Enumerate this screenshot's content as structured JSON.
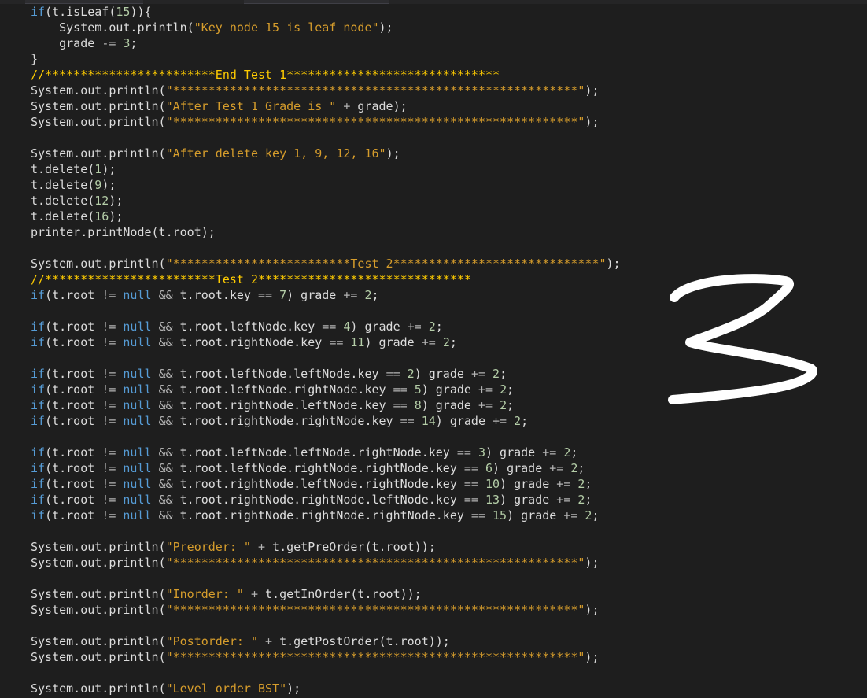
{
  "colors": {
    "background": "#1e1e1e",
    "text": "#dcdcdc",
    "keyword": "#569cd6",
    "string": "#d69d2c",
    "number": "#b5cea8",
    "comment": "#ffcc00",
    "operator": "#b4b4b4",
    "annotation": "#ffffff"
  },
  "annotation": {
    "icon": "handwritten-3-icon",
    "value": "3"
  },
  "code": {
    "lines": [
      [
        {
          "t": "kw",
          "s": "if"
        },
        {
          "t": "plain",
          "s": "(t.isLeaf("
        },
        {
          "t": "num",
          "s": "15"
        },
        {
          "t": "plain",
          "s": ")){"
        }
      ],
      [
        {
          "t": "plain",
          "s": "    System.out.println("
        },
        {
          "t": "str",
          "s": "\"Key node 15 is leaf node\""
        },
        {
          "t": "plain",
          "s": ");"
        }
      ],
      [
        {
          "t": "plain",
          "s": "    grade "
        },
        {
          "t": "op",
          "s": "-="
        },
        {
          "t": "plain",
          "s": " "
        },
        {
          "t": "num",
          "s": "3"
        },
        {
          "t": "plain",
          "s": ";"
        }
      ],
      [
        {
          "t": "plain",
          "s": "}"
        }
      ],
      [
        {
          "t": "cm",
          "s": "//************************End Test 1******************************"
        }
      ],
      [
        {
          "t": "plain",
          "s": "System.out.println("
        },
        {
          "t": "str",
          "s": "\"*********************************************************\""
        },
        {
          "t": "plain",
          "s": ");"
        }
      ],
      [
        {
          "t": "plain",
          "s": "System.out.println("
        },
        {
          "t": "str",
          "s": "\"After Test 1 Grade is \""
        },
        {
          "t": "plain",
          "s": " "
        },
        {
          "t": "op",
          "s": "+"
        },
        {
          "t": "plain",
          "s": " grade);"
        }
      ],
      [
        {
          "t": "plain",
          "s": "System.out.println("
        },
        {
          "t": "str",
          "s": "\"*********************************************************\""
        },
        {
          "t": "plain",
          "s": ");"
        }
      ],
      [],
      [
        {
          "t": "plain",
          "s": "System.out.println("
        },
        {
          "t": "str",
          "s": "\"After delete key 1, 9, 12, 16\""
        },
        {
          "t": "plain",
          "s": ");"
        }
      ],
      [
        {
          "t": "plain",
          "s": "t.delete("
        },
        {
          "t": "num",
          "s": "1"
        },
        {
          "t": "plain",
          "s": ");"
        }
      ],
      [
        {
          "t": "plain",
          "s": "t.delete("
        },
        {
          "t": "num",
          "s": "9"
        },
        {
          "t": "plain",
          "s": ");"
        }
      ],
      [
        {
          "t": "plain",
          "s": "t.delete("
        },
        {
          "t": "num",
          "s": "12"
        },
        {
          "t": "plain",
          "s": ");"
        }
      ],
      [
        {
          "t": "plain",
          "s": "t.delete("
        },
        {
          "t": "num",
          "s": "16"
        },
        {
          "t": "plain",
          "s": ");"
        }
      ],
      [
        {
          "t": "plain",
          "s": "printer.printNode(t.root);"
        }
      ],
      [],
      [
        {
          "t": "plain",
          "s": "System.out.println("
        },
        {
          "t": "str",
          "s": "\"*************************Test 2*****************************\""
        },
        {
          "t": "plain",
          "s": ");"
        }
      ],
      [
        {
          "t": "cm",
          "s": "//************************Test 2******************************"
        }
      ],
      [
        {
          "t": "kw",
          "s": "if"
        },
        {
          "t": "plain",
          "s": "(t.root "
        },
        {
          "t": "op",
          "s": "!="
        },
        {
          "t": "plain",
          "s": " "
        },
        {
          "t": "kw",
          "s": "null"
        },
        {
          "t": "plain",
          "s": " "
        },
        {
          "t": "op",
          "s": "&&"
        },
        {
          "t": "plain",
          "s": " t.root.key "
        },
        {
          "t": "op",
          "s": "=="
        },
        {
          "t": "plain",
          "s": " "
        },
        {
          "t": "num",
          "s": "7"
        },
        {
          "t": "plain",
          "s": ") grade "
        },
        {
          "t": "op",
          "s": "+="
        },
        {
          "t": "plain",
          "s": " "
        },
        {
          "t": "num",
          "s": "2"
        },
        {
          "t": "plain",
          "s": ";"
        }
      ],
      [],
      [
        {
          "t": "kw",
          "s": "if"
        },
        {
          "t": "plain",
          "s": "(t.root "
        },
        {
          "t": "op",
          "s": "!="
        },
        {
          "t": "plain",
          "s": " "
        },
        {
          "t": "kw",
          "s": "null"
        },
        {
          "t": "plain",
          "s": " "
        },
        {
          "t": "op",
          "s": "&&"
        },
        {
          "t": "plain",
          "s": " t.root.leftNode.key "
        },
        {
          "t": "op",
          "s": "=="
        },
        {
          "t": "plain",
          "s": " "
        },
        {
          "t": "num",
          "s": "4"
        },
        {
          "t": "plain",
          "s": ") grade "
        },
        {
          "t": "op",
          "s": "+="
        },
        {
          "t": "plain",
          "s": " "
        },
        {
          "t": "num",
          "s": "2"
        },
        {
          "t": "plain",
          "s": ";"
        }
      ],
      [
        {
          "t": "kw",
          "s": "if"
        },
        {
          "t": "plain",
          "s": "(t.root "
        },
        {
          "t": "op",
          "s": "!="
        },
        {
          "t": "plain",
          "s": " "
        },
        {
          "t": "kw",
          "s": "null"
        },
        {
          "t": "plain",
          "s": " "
        },
        {
          "t": "op",
          "s": "&&"
        },
        {
          "t": "plain",
          "s": " t.root.rightNode.key "
        },
        {
          "t": "op",
          "s": "=="
        },
        {
          "t": "plain",
          "s": " "
        },
        {
          "t": "num",
          "s": "11"
        },
        {
          "t": "plain",
          "s": ") grade "
        },
        {
          "t": "op",
          "s": "+="
        },
        {
          "t": "plain",
          "s": " "
        },
        {
          "t": "num",
          "s": "2"
        },
        {
          "t": "plain",
          "s": ";"
        }
      ],
      [],
      [
        {
          "t": "kw",
          "s": "if"
        },
        {
          "t": "plain",
          "s": "(t.root "
        },
        {
          "t": "op",
          "s": "!="
        },
        {
          "t": "plain",
          "s": " "
        },
        {
          "t": "kw",
          "s": "null"
        },
        {
          "t": "plain",
          "s": " "
        },
        {
          "t": "op",
          "s": "&&"
        },
        {
          "t": "plain",
          "s": " t.root.leftNode.leftNode.key "
        },
        {
          "t": "op",
          "s": "=="
        },
        {
          "t": "plain",
          "s": " "
        },
        {
          "t": "num",
          "s": "2"
        },
        {
          "t": "plain",
          "s": ") grade "
        },
        {
          "t": "op",
          "s": "+="
        },
        {
          "t": "plain",
          "s": " "
        },
        {
          "t": "num",
          "s": "2"
        },
        {
          "t": "plain",
          "s": ";"
        }
      ],
      [
        {
          "t": "kw",
          "s": "if"
        },
        {
          "t": "plain",
          "s": "(t.root "
        },
        {
          "t": "op",
          "s": "!="
        },
        {
          "t": "plain",
          "s": " "
        },
        {
          "t": "kw",
          "s": "null"
        },
        {
          "t": "plain",
          "s": " "
        },
        {
          "t": "op",
          "s": "&&"
        },
        {
          "t": "plain",
          "s": " t.root.leftNode.rightNode.key "
        },
        {
          "t": "op",
          "s": "=="
        },
        {
          "t": "plain",
          "s": " "
        },
        {
          "t": "num",
          "s": "5"
        },
        {
          "t": "plain",
          "s": ") grade "
        },
        {
          "t": "op",
          "s": "+="
        },
        {
          "t": "plain",
          "s": " "
        },
        {
          "t": "num",
          "s": "2"
        },
        {
          "t": "plain",
          "s": ";"
        }
      ],
      [
        {
          "t": "kw",
          "s": "if"
        },
        {
          "t": "plain",
          "s": "(t.root "
        },
        {
          "t": "op",
          "s": "!="
        },
        {
          "t": "plain",
          "s": " "
        },
        {
          "t": "kw",
          "s": "null"
        },
        {
          "t": "plain",
          "s": " "
        },
        {
          "t": "op",
          "s": "&&"
        },
        {
          "t": "plain",
          "s": " t.root.rightNode.leftNode.key "
        },
        {
          "t": "op",
          "s": "=="
        },
        {
          "t": "plain",
          "s": " "
        },
        {
          "t": "num",
          "s": "8"
        },
        {
          "t": "plain",
          "s": ") grade "
        },
        {
          "t": "op",
          "s": "+="
        },
        {
          "t": "plain",
          "s": " "
        },
        {
          "t": "num",
          "s": "2"
        },
        {
          "t": "plain",
          "s": ";"
        }
      ],
      [
        {
          "t": "kw",
          "s": "if"
        },
        {
          "t": "plain",
          "s": "(t.root "
        },
        {
          "t": "op",
          "s": "!="
        },
        {
          "t": "plain",
          "s": " "
        },
        {
          "t": "kw",
          "s": "null"
        },
        {
          "t": "plain",
          "s": " "
        },
        {
          "t": "op",
          "s": "&&"
        },
        {
          "t": "plain",
          "s": " t.root.rightNode.rightNode.key "
        },
        {
          "t": "op",
          "s": "=="
        },
        {
          "t": "plain",
          "s": " "
        },
        {
          "t": "num",
          "s": "14"
        },
        {
          "t": "plain",
          "s": ") grade "
        },
        {
          "t": "op",
          "s": "+="
        },
        {
          "t": "plain",
          "s": " "
        },
        {
          "t": "num",
          "s": "2"
        },
        {
          "t": "plain",
          "s": ";"
        }
      ],
      [],
      [
        {
          "t": "kw",
          "s": "if"
        },
        {
          "t": "plain",
          "s": "(t.root "
        },
        {
          "t": "op",
          "s": "!="
        },
        {
          "t": "plain",
          "s": " "
        },
        {
          "t": "kw",
          "s": "null"
        },
        {
          "t": "plain",
          "s": " "
        },
        {
          "t": "op",
          "s": "&&"
        },
        {
          "t": "plain",
          "s": " t.root.leftNode.leftNode.rightNode.key "
        },
        {
          "t": "op",
          "s": "=="
        },
        {
          "t": "plain",
          "s": " "
        },
        {
          "t": "num",
          "s": "3"
        },
        {
          "t": "plain",
          "s": ") grade "
        },
        {
          "t": "op",
          "s": "+="
        },
        {
          "t": "plain",
          "s": " "
        },
        {
          "t": "num",
          "s": "2"
        },
        {
          "t": "plain",
          "s": ";"
        }
      ],
      [
        {
          "t": "kw",
          "s": "if"
        },
        {
          "t": "plain",
          "s": "(t.root "
        },
        {
          "t": "op",
          "s": "!="
        },
        {
          "t": "plain",
          "s": " "
        },
        {
          "t": "kw",
          "s": "null"
        },
        {
          "t": "plain",
          "s": " "
        },
        {
          "t": "op",
          "s": "&&"
        },
        {
          "t": "plain",
          "s": " t.root.leftNode.rightNode.rightNode.key "
        },
        {
          "t": "op",
          "s": "=="
        },
        {
          "t": "plain",
          "s": " "
        },
        {
          "t": "num",
          "s": "6"
        },
        {
          "t": "plain",
          "s": ") grade "
        },
        {
          "t": "op",
          "s": "+="
        },
        {
          "t": "plain",
          "s": " "
        },
        {
          "t": "num",
          "s": "2"
        },
        {
          "t": "plain",
          "s": ";"
        }
      ],
      [
        {
          "t": "kw",
          "s": "if"
        },
        {
          "t": "plain",
          "s": "(t.root "
        },
        {
          "t": "op",
          "s": "!="
        },
        {
          "t": "plain",
          "s": " "
        },
        {
          "t": "kw",
          "s": "null"
        },
        {
          "t": "plain",
          "s": " "
        },
        {
          "t": "op",
          "s": "&&"
        },
        {
          "t": "plain",
          "s": " t.root.rightNode.leftNode.rightNode.key "
        },
        {
          "t": "op",
          "s": "=="
        },
        {
          "t": "plain",
          "s": " "
        },
        {
          "t": "num",
          "s": "10"
        },
        {
          "t": "plain",
          "s": ") grade "
        },
        {
          "t": "op",
          "s": "+="
        },
        {
          "t": "plain",
          "s": " "
        },
        {
          "t": "num",
          "s": "2"
        },
        {
          "t": "plain",
          "s": ";"
        }
      ],
      [
        {
          "t": "kw",
          "s": "if"
        },
        {
          "t": "plain",
          "s": "(t.root "
        },
        {
          "t": "op",
          "s": "!="
        },
        {
          "t": "plain",
          "s": " "
        },
        {
          "t": "kw",
          "s": "null"
        },
        {
          "t": "plain",
          "s": " "
        },
        {
          "t": "op",
          "s": "&&"
        },
        {
          "t": "plain",
          "s": " t.root.rightNode.rightNode.leftNode.key "
        },
        {
          "t": "op",
          "s": "=="
        },
        {
          "t": "plain",
          "s": " "
        },
        {
          "t": "num",
          "s": "13"
        },
        {
          "t": "plain",
          "s": ") grade "
        },
        {
          "t": "op",
          "s": "+="
        },
        {
          "t": "plain",
          "s": " "
        },
        {
          "t": "num",
          "s": "2"
        },
        {
          "t": "plain",
          "s": ";"
        }
      ],
      [
        {
          "t": "kw",
          "s": "if"
        },
        {
          "t": "plain",
          "s": "(t.root "
        },
        {
          "t": "op",
          "s": "!="
        },
        {
          "t": "plain",
          "s": " "
        },
        {
          "t": "kw",
          "s": "null"
        },
        {
          "t": "plain",
          "s": " "
        },
        {
          "t": "op",
          "s": "&&"
        },
        {
          "t": "plain",
          "s": " t.root.rightNode.rightNode.rightNode.key "
        },
        {
          "t": "op",
          "s": "=="
        },
        {
          "t": "plain",
          "s": " "
        },
        {
          "t": "num",
          "s": "15"
        },
        {
          "t": "plain",
          "s": ") grade "
        },
        {
          "t": "op",
          "s": "+="
        },
        {
          "t": "plain",
          "s": " "
        },
        {
          "t": "num",
          "s": "2"
        },
        {
          "t": "plain",
          "s": ";"
        }
      ],
      [],
      [
        {
          "t": "plain",
          "s": "System.out.println("
        },
        {
          "t": "str",
          "s": "\"Preorder: \""
        },
        {
          "t": "plain",
          "s": " "
        },
        {
          "t": "op",
          "s": "+"
        },
        {
          "t": "plain",
          "s": " t.getPreOrder(t.root));"
        }
      ],
      [
        {
          "t": "plain",
          "s": "System.out.println("
        },
        {
          "t": "str",
          "s": "\"*********************************************************\""
        },
        {
          "t": "plain",
          "s": ");"
        }
      ],
      [],
      [
        {
          "t": "plain",
          "s": "System.out.println("
        },
        {
          "t": "str",
          "s": "\"Inorder: \""
        },
        {
          "t": "plain",
          "s": " "
        },
        {
          "t": "op",
          "s": "+"
        },
        {
          "t": "plain",
          "s": " t.getInOrder(t.root));"
        }
      ],
      [
        {
          "t": "plain",
          "s": "System.out.println("
        },
        {
          "t": "str",
          "s": "\"*********************************************************\""
        },
        {
          "t": "plain",
          "s": ");"
        }
      ],
      [],
      [
        {
          "t": "plain",
          "s": "System.out.println("
        },
        {
          "t": "str",
          "s": "\"Postorder: \""
        },
        {
          "t": "plain",
          "s": " "
        },
        {
          "t": "op",
          "s": "+"
        },
        {
          "t": "plain",
          "s": " t.getPostOrder(t.root));"
        }
      ],
      [
        {
          "t": "plain",
          "s": "System.out.println("
        },
        {
          "t": "str",
          "s": "\"*********************************************************\""
        },
        {
          "t": "plain",
          "s": ");"
        }
      ],
      [],
      [
        {
          "t": "plain",
          "s": "System.out.println("
        },
        {
          "t": "str",
          "s": "\"Level order BST\""
        },
        {
          "t": "plain",
          "s": ");"
        }
      ]
    ]
  }
}
